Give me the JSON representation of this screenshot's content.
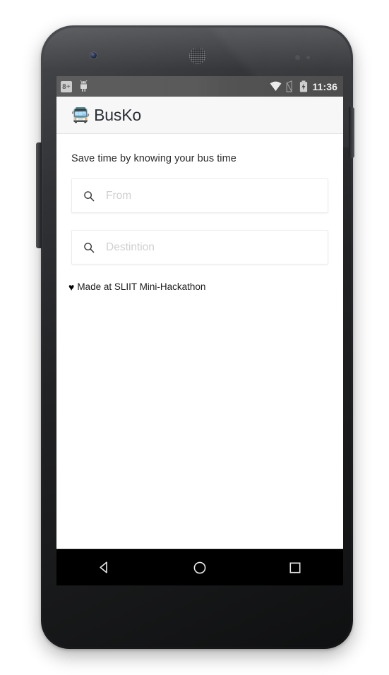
{
  "device": {
    "name": "android-phone-frame",
    "camera": "front-camera",
    "speaker": "earpiece-speaker",
    "volume_button": "volume-rocker",
    "power_button": "power-button"
  },
  "status_bar": {
    "left_icons": [
      {
        "name": "google-plus-icon",
        "glyph": "8+"
      },
      {
        "name": "android-droid-icon",
        "glyph": "android"
      }
    ],
    "right_icons": [
      {
        "name": "wifi-icon",
        "glyph": "wifi"
      },
      {
        "name": "no-sim-icon",
        "glyph": "no-sim"
      },
      {
        "name": "battery-charging-icon",
        "glyph": "battery-charging"
      }
    ],
    "clock": "11:36",
    "background_color": "#565656"
  },
  "app_bar": {
    "bus_icon": "🚍",
    "title": "BusKo",
    "background_color": "#f7f7f7",
    "title_color": "#2b2f36"
  },
  "main": {
    "tagline": "Save time by knowing your bus time",
    "fields": [
      {
        "name": "from",
        "icon": "search-icon",
        "value": "",
        "placeholder": "From"
      },
      {
        "name": "destination",
        "icon": "search-icon",
        "value": "",
        "placeholder": "Destintion"
      }
    ],
    "credit": {
      "heart": "♥",
      "text": "Made at SLIIT Mini-Hackathon"
    },
    "background_color": "#ffffff"
  },
  "nav_bar": {
    "buttons": [
      {
        "name": "back-button",
        "glyph": "triangle-left"
      },
      {
        "name": "home-button",
        "glyph": "circle"
      },
      {
        "name": "recents-button",
        "glyph": "square"
      }
    ],
    "background_color": "#000000"
  }
}
